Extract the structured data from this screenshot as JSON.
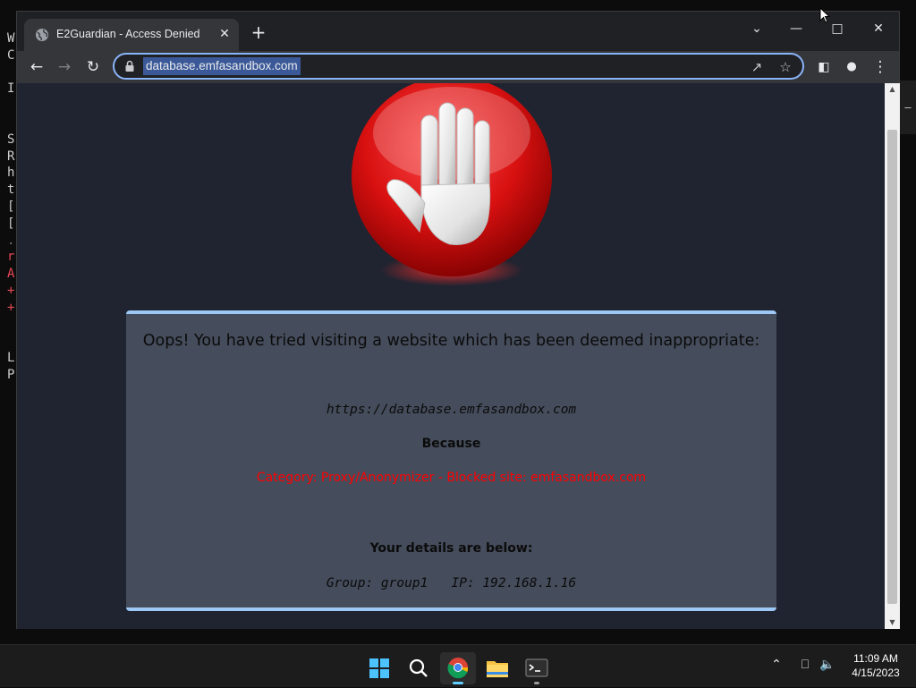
{
  "terminal": {
    "lines": [
      {
        "text": "W",
        "tone": "normal"
      },
      {
        "text": "C",
        "tone": "normal"
      },
      {
        "text": "",
        "tone": "normal"
      },
      {
        "text": "I",
        "tone": "normal"
      },
      {
        "text": "",
        "tone": "normal"
      },
      {
        "text": "",
        "tone": "normal"
      },
      {
        "text": "S",
        "tone": "normal"
      },
      {
        "text": "R",
        "tone": "normal"
      },
      {
        "text": "h",
        "tone": "normal"
      },
      {
        "text": "t",
        "tone": "normal"
      },
      {
        "text": "[",
        "tone": "normal"
      },
      {
        "text": "[",
        "tone": "normal"
      },
      {
        "text": ".",
        "tone": "dim"
      },
      {
        "text": "r",
        "tone": "red"
      },
      {
        "text": "A",
        "tone": "red"
      },
      {
        "text": "+",
        "tone": "red"
      },
      {
        "text": "+",
        "tone": "red"
      },
      {
        "text": "",
        "tone": "normal"
      },
      {
        "text": "",
        "tone": "normal"
      },
      {
        "text": "L",
        "tone": "normal"
      },
      {
        "text": "P",
        "tone": "normal"
      }
    ],
    "right_fragment": "—"
  },
  "browser": {
    "tab": {
      "title": "E2Guardian - Access Denied",
      "close_glyph": "✕"
    },
    "new_tab_glyph": "+",
    "window_controls": {
      "tab_search": "⌄",
      "minimize": "—",
      "maximize": "□",
      "close": "✕"
    },
    "nav": {
      "back": "←",
      "forward": "→",
      "reload": "↻"
    },
    "address_bar": {
      "url": "database.emfasandbox.com",
      "share_glyph": "↗",
      "bookmark_glyph": "☆"
    },
    "toolbar_right": {
      "side_panel": "◧",
      "profile": "●",
      "menu": "⋮"
    }
  },
  "page": {
    "heading": "Oops! You have tried visiting a website which has been deemed inappropriate:",
    "blocked_url": "https://database.emfasandbox.com",
    "because_label": "Because",
    "reason": "Category: Proxy/Anonymizer - Blocked site: emfasandbox.com",
    "details_heading": "Your details are below:",
    "details": "Group: group1   IP: 192.168.1.16"
  },
  "scrollbar": {
    "up": "▲",
    "down": "▼"
  },
  "taskbar": {
    "tray": {
      "chevron": "⌃",
      "network_glyph": "⎕",
      "volume_glyph": "🔈"
    },
    "clock": {
      "time": "11:09 AM",
      "date": "4/15/2023"
    }
  },
  "colors": {
    "accent_blue": "#8ab4f8",
    "panel_border": "#9dc8f5",
    "reason_red": "#ff0000",
    "page_bg": "#1f2430",
    "panel_bg": "#454c5b"
  }
}
